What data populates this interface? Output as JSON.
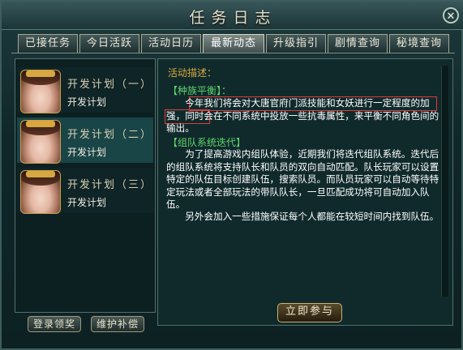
{
  "window": {
    "title": "任务日志",
    "close_label": "✕"
  },
  "tabs": [
    {
      "label": "已接任务",
      "active": false
    },
    {
      "label": "今日活跃",
      "active": false
    },
    {
      "label": "活动日历",
      "active": false
    },
    {
      "label": "最新动态",
      "active": true
    },
    {
      "label": "升级指引",
      "active": false
    },
    {
      "label": "剧情查询",
      "active": false
    },
    {
      "label": "秘境查询",
      "active": false
    }
  ],
  "entries": [
    {
      "name": "开发计划（一）",
      "sub": "开发计划",
      "selected": false
    },
    {
      "name": "开发计划（二）",
      "sub": "开发计划",
      "selected": true
    },
    {
      "name": "开发计划（三）",
      "sub": "开发计划",
      "selected": false
    }
  ],
  "buttons": {
    "login_reward": "登录领奖",
    "maintenance_comp": "维护补偿",
    "join_now": "立即参与"
  },
  "description": {
    "heading": "活动描述：",
    "sections": [
      {
        "title": "【种族平衡】：",
        "text": "今年我们将会对大唐官府门派技能和女妖进行一定程度的加强，同时会在不同系统中投放一些抗毒属性，来平衡不同角色间的输出。"
      },
      {
        "title": "【组队系统迭代】",
        "text": "为了提高游戏内组队体验，近期我们将迭代组队系统。迭代后的组队系统将支持队长和队员的双向自动匹配。队长玩家可以设置特定的队伍目标创建队伍，搜索队员。而队员玩家可以自动等待特定玩法或者全部玩法的带队队长，一旦匹配成功将可自动加入队伍。"
      },
      {
        "title": "",
        "text": "另外会加入一些措施保证每个人都能在较短时间内找到队伍。"
      }
    ]
  },
  "colors": {
    "section_title": "#5fd36c",
    "heading": "#d8a93c",
    "highlight_box": "#e13a3a"
  }
}
